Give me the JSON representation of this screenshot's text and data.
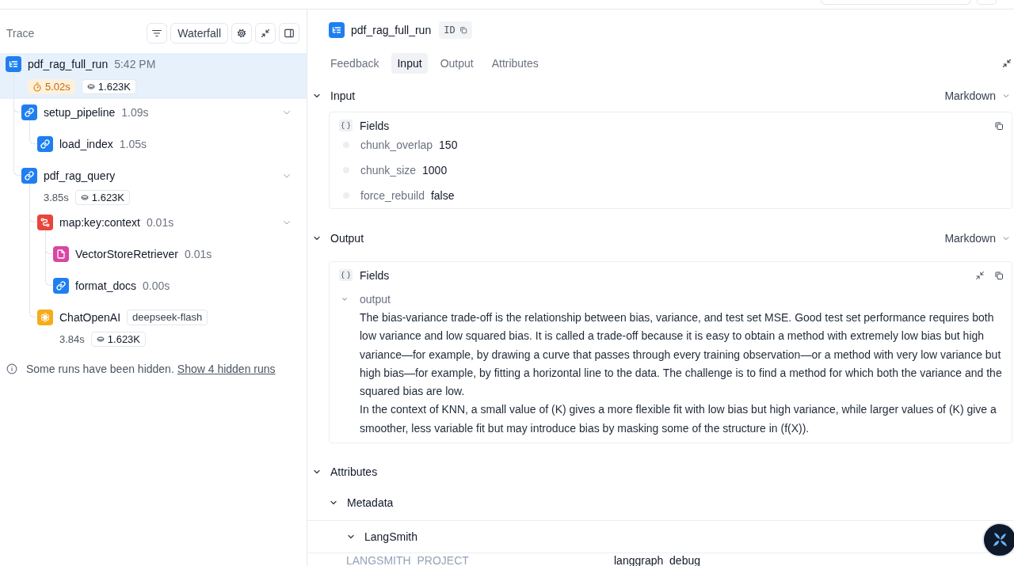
{
  "trace_panel": {
    "title": "Trace",
    "view_button": "Waterfall",
    "nodes": [
      {
        "name": "pdf_rag_full_run",
        "kind": "root",
        "color": "#1f7ff0",
        "start_time": "5:42 PM",
        "selected": true,
        "stats": {
          "latency": "5.02s",
          "slow": true,
          "tokens": "1.623K"
        },
        "children": [
          {
            "name": "setup_pipeline",
            "kind": "chain",
            "color": "#1f7ff0",
            "duration": "1.09s",
            "expanded": true,
            "selected": false,
            "children": [
              {
                "name": "load_index",
                "kind": "chain",
                "color": "#1f7ff0",
                "duration": "1.05s",
                "selected": false
              }
            ]
          },
          {
            "name": "pdf_rag_query",
            "kind": "chain",
            "color": "#1f7ff0",
            "expanded": true,
            "selected": false,
            "stats": {
              "latency": "3.85s",
              "slow": false,
              "tokens": "1.623K"
            },
            "children": [
              {
                "name": "map:key:context",
                "kind": "map",
                "color": "#e8453c",
                "duration": "0.01s",
                "expanded": true,
                "selected": false,
                "children": [
                  {
                    "name": "VectorStoreRetriever",
                    "kind": "retriever",
                    "color": "#d946a3",
                    "duration": "0.01s",
                    "selected": false
                  },
                  {
                    "name": "format_docs",
                    "kind": "chain",
                    "color": "#1f7ff0",
                    "duration": "0.00s",
                    "selected": false
                  }
                ]
              },
              {
                "name": "ChatOpenAI",
                "kind": "llm",
                "color": "#f6ac1c",
                "tag": "deepseek-flash",
                "selected": false,
                "stats": {
                  "latency": "3.84s",
                  "slow": false,
                  "tokens": "1.623K"
                }
              }
            ]
          }
        ]
      }
    ],
    "hidden_note": {
      "text": "Some runs have been hidden.",
      "link": "Show 4 hidden runs"
    }
  },
  "detail": {
    "title": "pdf_rag_full_run",
    "id_label": "ID",
    "tabs": [
      {
        "label": "Feedback",
        "selected": false
      },
      {
        "label": "Input",
        "selected": true
      },
      {
        "label": "Output",
        "selected": false
      },
      {
        "label": "Attributes",
        "selected": false
      }
    ],
    "sections": [
      {
        "kind": "fields",
        "title": "Input",
        "format": "Markdown",
        "expanded": true,
        "fields_label": "Fields",
        "fields": [
          {
            "key": "chunk_overlap",
            "value": "150"
          },
          {
            "key": "chunk_size",
            "value": "1000"
          },
          {
            "key": "force_rebuild",
            "value": "false"
          }
        ]
      },
      {
        "kind": "text",
        "title": "Output",
        "format": "Markdown",
        "expanded": true,
        "fields_label": "Fields",
        "field": {
          "key": "output",
          "expanded": true,
          "paragraphs": [
            "The bias-variance trade-off is the relationship between bias, variance, and test set MSE. Good test set performance requires both low variance and low squared bias. It is called a trade-off because it is easy to obtain a method with extremely low bias but high variance—for example, by drawing a curve that passes through every training observation—or a method with very low variance but high bias—for example, by fitting a horizontal line to the data. The challenge is to find a method for which both the variance and the squared bias are low.",
            "In the context of KNN, a small value of (K) gives a more flexible fit with low bias but high variance, while larger values of (K) give a smoother, less variable fit but may introduce bias by masking some of the structure in (f(X))."
          ]
        }
      }
    ],
    "attributes": {
      "title": "Attributes",
      "expanded": true,
      "groups": [
        {
          "title": "Metadata",
          "expanded": true,
          "children": [
            {
              "title": "LangSmith",
              "expanded": true,
              "rows": [
                {
                  "key": "LANGSMITH_PROJECT",
                  "value": "langgraph_debug"
                }
              ]
            }
          ]
        }
      ]
    }
  }
}
